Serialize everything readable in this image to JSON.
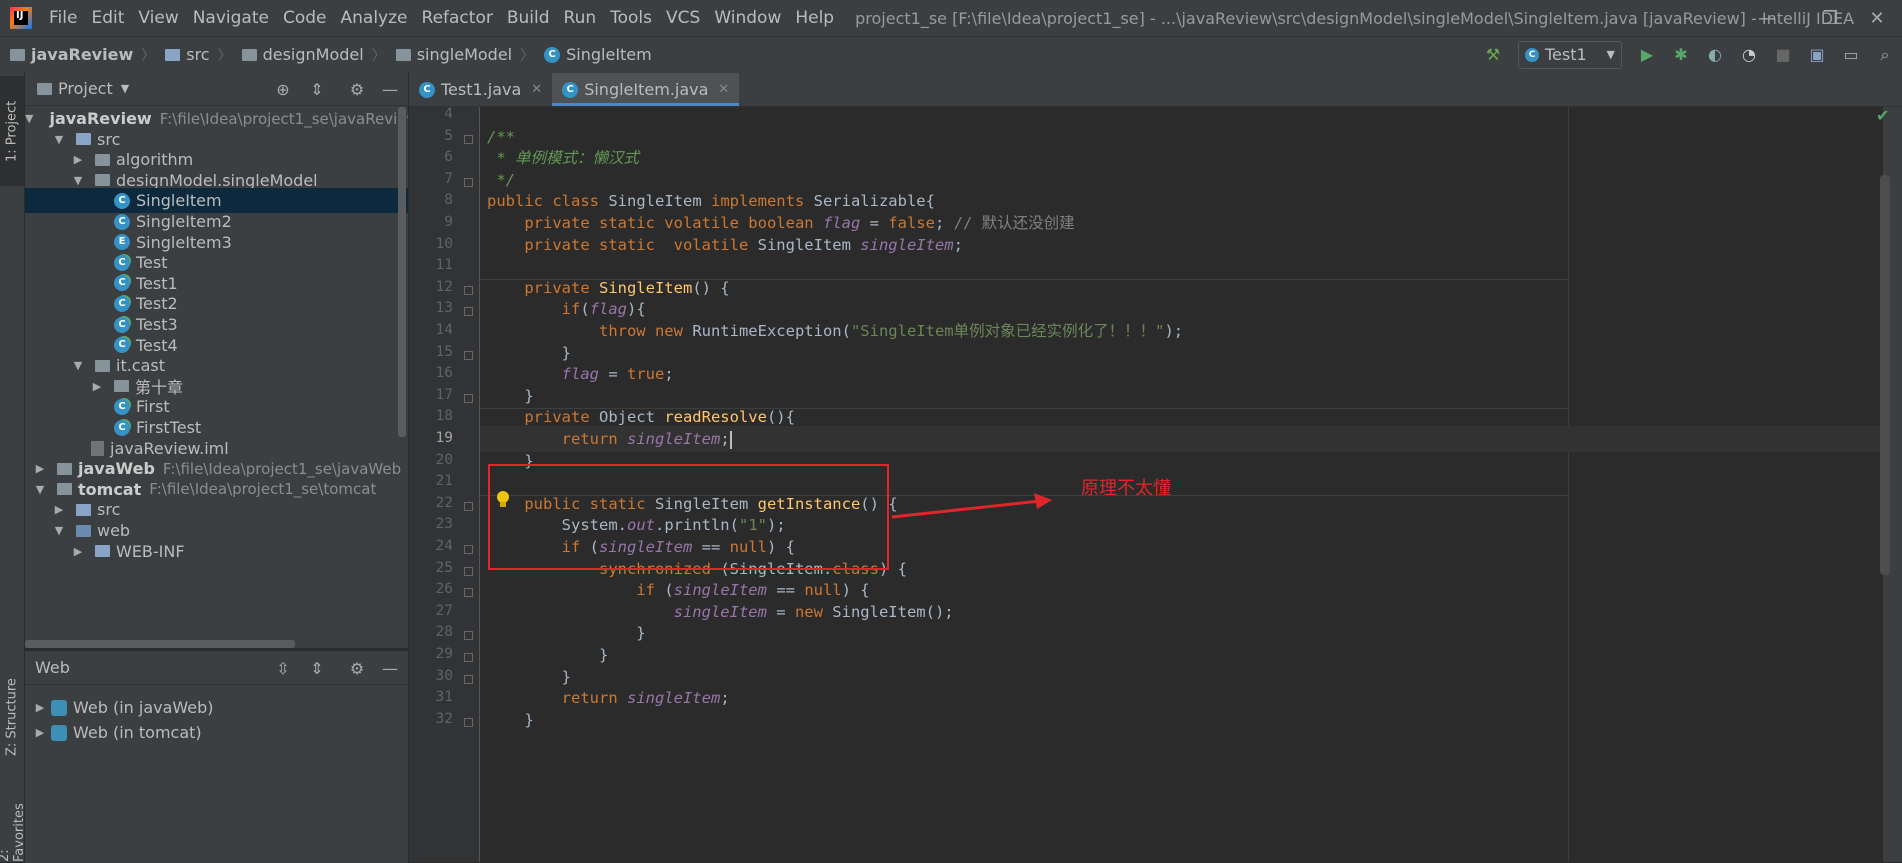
{
  "menu": [
    "File",
    "Edit",
    "View",
    "Navigate",
    "Code",
    "Analyze",
    "Refactor",
    "Build",
    "Run",
    "Tools",
    "VCS",
    "Window",
    "Help"
  ],
  "window_title": "project1_se [F:\\file\\Idea\\project1_se] - ...\\javaReview\\src\\designModel\\singleModel\\SingleItem.java [javaReview] - IntelliJ IDEA",
  "logo_text": "IJ",
  "breadcrumb": [
    "javaReview",
    "src",
    "designModel",
    "singleModel",
    "SingleItem"
  ],
  "run_config": "Test1",
  "left_strip": {
    "project_tab": "1: Project",
    "structure_tab": "Z: Structure",
    "favorites_tab": "2: Favorites"
  },
  "project_panel": {
    "title": "Project",
    "tree": [
      {
        "label": "javaReview",
        "path": "F:\\file\\Idea\\project1_se\\javaReview",
        "bold": true,
        "arrow": "▼",
        "indent": 0,
        "icon": "folder-dark"
      },
      {
        "label": "src",
        "arrow": "▼",
        "indent": 1,
        "icon": "folder"
      },
      {
        "label": "algorithm",
        "arrow": "▶",
        "indent": 2,
        "icon": "package"
      },
      {
        "label": "designModel.singleModel",
        "arrow": "▼",
        "indent": 2,
        "icon": "package"
      },
      {
        "label": "SingleItem",
        "indent": 3,
        "icon": "class",
        "selected": true
      },
      {
        "label": "SingleItem2",
        "indent": 3,
        "icon": "class"
      },
      {
        "label": "SingleItem3",
        "indent": 3,
        "icon": "enum"
      },
      {
        "label": "Test",
        "indent": 3,
        "icon": "class-run"
      },
      {
        "label": "Test1",
        "indent": 3,
        "icon": "class-run"
      },
      {
        "label": "Test2",
        "indent": 3,
        "icon": "class-run"
      },
      {
        "label": "Test3",
        "indent": 3,
        "icon": "class-run"
      },
      {
        "label": "Test4",
        "indent": 3,
        "icon": "class-run"
      },
      {
        "label": "it.cast",
        "arrow": "▼",
        "indent": 2,
        "icon": "package"
      },
      {
        "label": "第十章",
        "arrow": "▶",
        "indent": 3,
        "icon": "package"
      },
      {
        "label": "First",
        "indent": 3,
        "icon": "class-run"
      },
      {
        "label": "FirstTest",
        "indent": 3,
        "icon": "class-run"
      },
      {
        "label": "javaReview.iml",
        "indent": 2,
        "icon": "iml"
      },
      {
        "label": "javaWeb",
        "path": "F:\\file\\Idea\\project1_se\\javaWeb",
        "bold": true,
        "arrow": "▶",
        "indent": 0,
        "icon": "folder-dark"
      },
      {
        "label": "tomcat",
        "path": "F:\\file\\Idea\\project1_se\\tomcat",
        "bold": true,
        "arrow": "▼",
        "indent": 0,
        "icon": "folder-dark"
      },
      {
        "label": "src",
        "arrow": "▶",
        "indent": 1,
        "icon": "folder"
      },
      {
        "label": "web",
        "arrow": "▼",
        "indent": 1,
        "icon": "folder-web"
      },
      {
        "label": "WEB-INF",
        "arrow": "▶",
        "indent": 2,
        "icon": "folder"
      }
    ]
  },
  "web_panel": {
    "title": "Web",
    "items": [
      {
        "label": "Web (in javaWeb)"
      },
      {
        "label": "Web (in tomcat)"
      }
    ]
  },
  "editor_tabs": [
    {
      "label": "Test1.java",
      "active": false
    },
    {
      "label": "SingleItem.java",
      "active": true
    }
  ],
  "code": {
    "current_line": 19,
    "lines": [
      {
        "n": "4",
        "html": ""
      },
      {
        "n": "5",
        "html": "<span class='cm'>/**</span>"
      },
      {
        "n": "6",
        "html": "<span class='cm'> * 单例模式：懒汉式</span>"
      },
      {
        "n": "7",
        "html": "<span class='cm'> */</span>"
      },
      {
        "n": "8",
        "html": "<span class='kw'>public class </span>SingleItem <span class='kw'>implements </span>Serializable{"
      },
      {
        "n": "9",
        "html": "    <span class='kw'>private static volatile boolean </span><span class='fld'>flag </span>= <span class='kw'>false</span>; <span class='lc'>// 默认还没创建</span>"
      },
      {
        "n": "10",
        "html": "    <span class='kw'>private static  volatile </span>SingleItem <span class='fld'>singleItem</span>;"
      },
      {
        "n": "11",
        "html": ""
      },
      {
        "n": "12",
        "html": "    <span class='kw'>private </span><span class='fn'>SingleItem</span>() {"
      },
      {
        "n": "13",
        "html": "        <span class='kw'>if</span>(<span class='fld'>flag</span>){"
      },
      {
        "n": "14",
        "html": "            <span class='kw'>throw new </span>RuntimeException(<span class='str'>\"SingleItem单例对象已经实例化了！！！\"</span>);"
      },
      {
        "n": "15",
        "html": "        }"
      },
      {
        "n": "16",
        "html": "        <span class='fld'>flag </span>= <span class='kw'>true</span>;"
      },
      {
        "n": "17",
        "html": "    }"
      },
      {
        "n": "18",
        "html": "    <span class='kw'>private </span>Object <span class='fn'>readResolve</span>(){"
      },
      {
        "n": "19",
        "html": "        <span class='kw'>return </span><span class='fld'>singleItem</span>;"
      },
      {
        "n": "20",
        "html": "    }"
      },
      {
        "n": "21",
        "html": ""
      },
      {
        "n": "22",
        "html": "    <span class='kw'>public static </span>SingleItem <span class='fn'>getInstance</span>() {"
      },
      {
        "n": "23",
        "html": "        System.<span class='fld'>out</span>.println(<span class='str'>\"1\"</span>);"
      },
      {
        "n": "24",
        "html": "        <span class='kw'>if </span>(<span class='fld'>singleItem </span>== <span class='kw'>null</span>) {"
      },
      {
        "n": "25",
        "html": "            <span class='kw'>synchronized </span>(SingleItem.<span class='kw'>class</span>) {"
      },
      {
        "n": "26",
        "html": "                <span class='kw'>if </span>(<span class='fld'>singleItem </span>== <span class='kw'>null</span>) {"
      },
      {
        "n": "27",
        "html": "                    <span class='fld'>singleItem </span>= <span class='kw'>new </span>SingleItem();"
      },
      {
        "n": "28",
        "html": "                }"
      },
      {
        "n": "29",
        "html": "            }"
      },
      {
        "n": "30",
        "html": "        }"
      },
      {
        "n": "31",
        "html": "        <span class='kw'>return </span><span class='fld'>singleItem</span>;"
      },
      {
        "n": "32",
        "html": "    }"
      }
    ]
  },
  "annotation": {
    "note": "原理不太懂",
    "color": "#e0262b"
  },
  "colors": {
    "keyword": "#cc7832",
    "comment": "#629755",
    "field": "#9876aa",
    "method": "#ffc66d",
    "string": "#6a8759",
    "selection": "#0d293e",
    "accent": "#4a88c7"
  }
}
